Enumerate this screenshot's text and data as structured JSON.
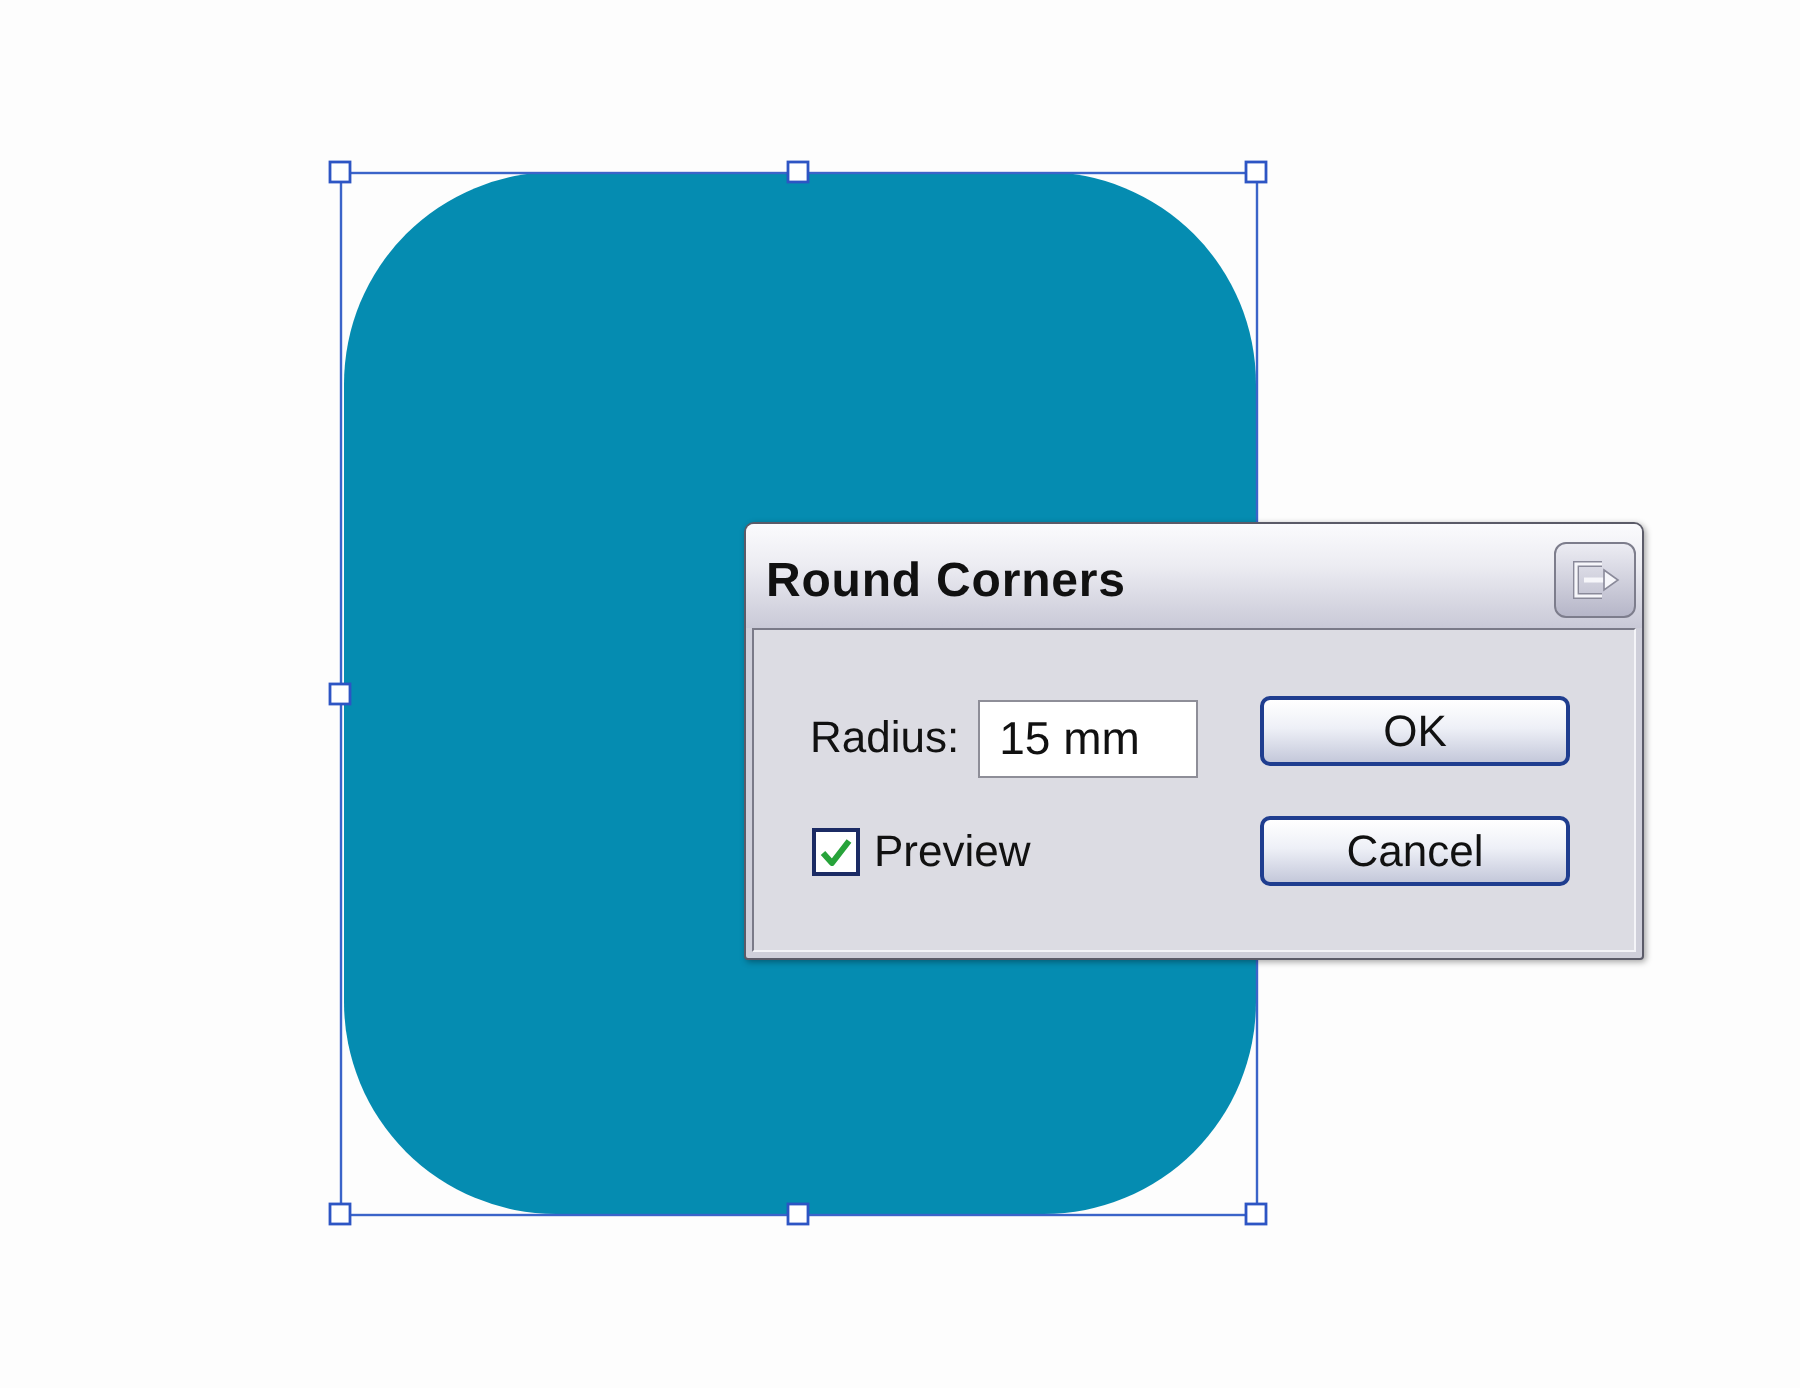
{
  "canvas": {
    "shape": {
      "kind": "rounded-rectangle",
      "selected": true
    }
  },
  "dialog": {
    "title": "Round Corners",
    "radius": {
      "label": "Radius:",
      "value": "15 mm"
    },
    "preview": {
      "label": "Preview",
      "checked": true
    },
    "buttons": [
      {
        "label": "OK"
      },
      {
        "label": "Cancel"
      }
    ]
  }
}
